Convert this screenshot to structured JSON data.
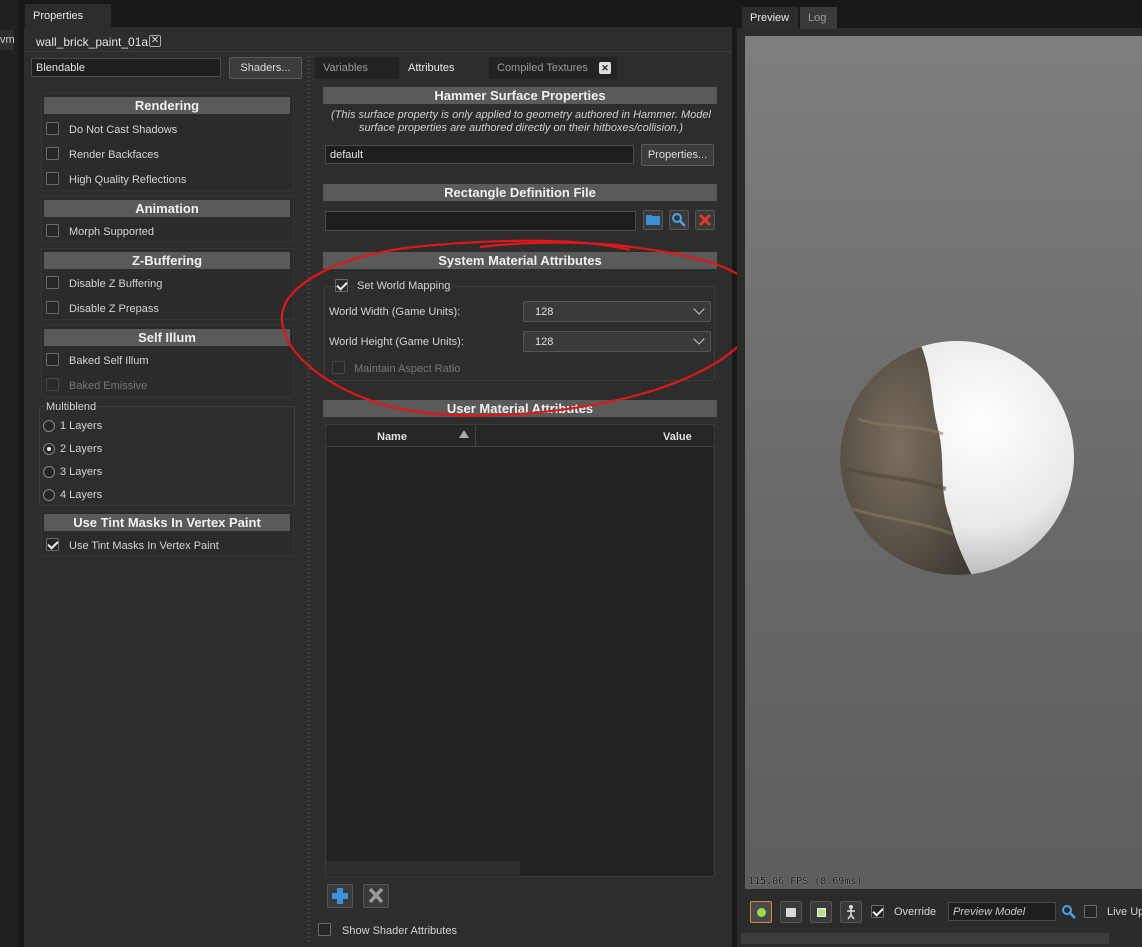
{
  "window": {
    "left_tab": "Properties",
    "left_edge_fragment": "vm",
    "doc_tab": "wall_brick_paint_01a"
  },
  "left": {
    "shader_value": "Blendable",
    "shaders_button": "Shaders...",
    "rendering": {
      "title": "Rendering",
      "items": [
        {
          "label": "Do Not Cast Shadows",
          "checked": false
        },
        {
          "label": "Render Backfaces",
          "checked": false
        },
        {
          "label": "High Quality Reflections",
          "checked": false
        }
      ]
    },
    "animation": {
      "title": "Animation",
      "items": [
        {
          "label": "Morph Supported",
          "checked": false
        }
      ]
    },
    "zbuffer": {
      "title": "Z-Buffering",
      "items": [
        {
          "label": "Disable Z Buffering",
          "checked": false
        },
        {
          "label": "Disable Z Prepass",
          "checked": false
        }
      ]
    },
    "selfillum": {
      "title": "Self Illum",
      "items": [
        {
          "label": "Baked Self Illum",
          "checked": false
        },
        {
          "label": "Baked Emissive",
          "checked": false,
          "disabled": true
        }
      ]
    },
    "multiblend": {
      "title": "Multiblend",
      "options": [
        "1 Layers",
        "2 Layers",
        "3 Layers",
        "4 Layers"
      ],
      "selected": "2 Layers"
    },
    "tint": {
      "title": "Use Tint Masks In Vertex Paint",
      "item": {
        "label": "Use Tint Masks In Vertex Paint",
        "checked": true
      }
    }
  },
  "middle": {
    "tabs": [
      "Variables",
      "Attributes",
      "Compiled Textures"
    ],
    "active_tab": "Attributes",
    "hammer": {
      "title": "Hammer Surface Properties",
      "note": "(This surface property is only applied to geometry authored in Hammer. Model surface properties are authored directly on their hitboxes/collision.)",
      "value": "default",
      "button": "Properties..."
    },
    "rect": {
      "title": "Rectangle Definition File",
      "value": ""
    },
    "system": {
      "title": "System Material Attributes",
      "set_world_mapping": "Set World Mapping",
      "width_label": "World Width (Game Units):",
      "width_value": "128",
      "height_label": "World Height (Game Units):",
      "height_value": "128",
      "maintain": "Maintain Aspect Ratio"
    },
    "user": {
      "title": "User Material Attributes",
      "col_name": "Name",
      "col_value": "Value"
    },
    "show_shader_attrs": "Show Shader Attributes"
  },
  "right": {
    "tabs": [
      "Preview",
      "Log"
    ],
    "active_tab": "Preview",
    "fps": "115.06 FPS (8.69ms)",
    "override_label": "Override",
    "model_placeholder": "Preview Model",
    "live_update": "Live Up"
  },
  "colors": {
    "annotation": "#e01818",
    "panel": "#2d2d2d",
    "header": "#5a5a5a"
  }
}
